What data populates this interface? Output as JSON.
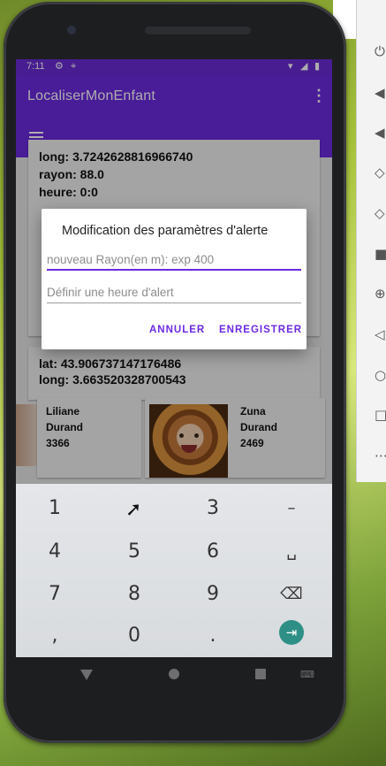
{
  "statusbar": {
    "time": "7:11"
  },
  "app": {
    "title": "LocaliserMonEnfant"
  },
  "background": {
    "card1": {
      "long": "long: 3.7242628816966740",
      "rayon": "rayon: 88.0",
      "heure": "heure: 0:0"
    },
    "card2": {
      "lat": "lat: 43.906737147176486",
      "long": "long: 3.663520328700543"
    },
    "children": [
      {
        "first_name": "Liliane",
        "last_name": "Durand",
        "code": "3366"
      },
      {
        "first_name": "Zuna",
        "last_name": "Durand",
        "code": "2469"
      }
    ]
  },
  "dialog": {
    "title": "Modification des paramètres d'alerte",
    "rayon_placeholder": "nouveau Rayon(en m): exp 400",
    "heure_placeholder": "Définir une heure d'alert",
    "cancel_label": "ANNULER",
    "save_label": "ENREGISTRER"
  },
  "keyboard": {
    "keys": [
      "1",
      "2",
      "3",
      "–",
      "4",
      "5",
      "6",
      "␣",
      "7",
      "8",
      "9",
      "⌫",
      ",",
      "0",
      ".",
      "⇥"
    ]
  },
  "colors": {
    "primary": "#6c2ae0",
    "statusbar": "#6a2bd6",
    "enter_key": "#2e8f86"
  },
  "icons": {
    "emulator_toolbar": [
      "power-icon",
      "volume-up-icon",
      "volume-down-icon",
      "rotate-left-icon",
      "rotate-right-icon",
      "camera-icon",
      "zoom-icon",
      "back-icon",
      "home-icon",
      "overview-icon",
      "more-icon"
    ]
  }
}
